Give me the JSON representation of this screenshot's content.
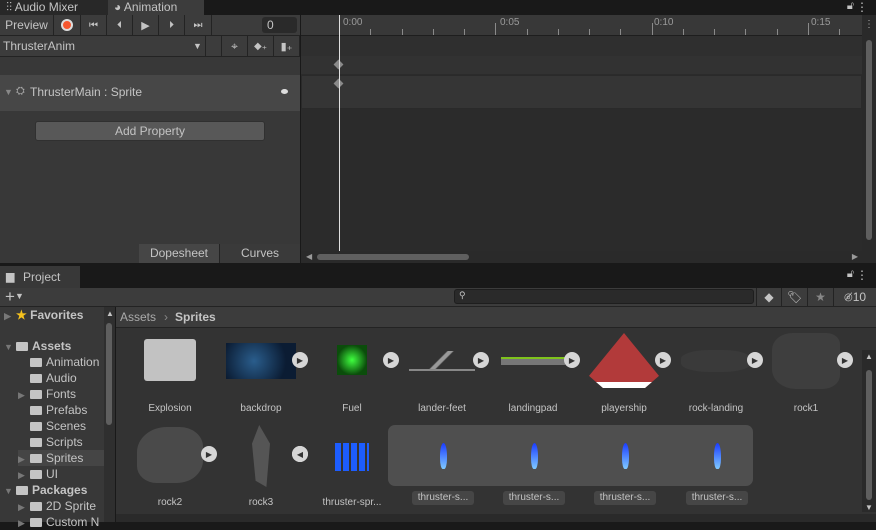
{
  "tabs": {
    "audio_mixer": "Audio Mixer",
    "animation": "Animation"
  },
  "animation": {
    "preview_label": "Preview",
    "frame_value": "0",
    "clip_name": "ThrusterAnim",
    "property_label": "ThrusterMain : Sprite",
    "add_property": "Add Property",
    "mode_tabs": [
      "Dopesheet",
      "Curves"
    ],
    "time_labels": [
      "0:00",
      "0:05",
      "0:10",
      "0:15"
    ]
  },
  "project": {
    "tab_label": "Project",
    "search_placeholder": "",
    "hidden_count": "10",
    "breadcrumb": [
      "Assets",
      "Sprites"
    ],
    "tree": {
      "favorites": "Favorites",
      "assets": "Assets",
      "asset_folders": [
        "Animation",
        "Audio",
        "Fonts",
        "Prefabs",
        "Scenes",
        "Scripts",
        "Sprites",
        "UI"
      ],
      "packages": "Packages",
      "package_folders": [
        "2D Sprite",
        "Custom N"
      ]
    },
    "items_row1": [
      "Explosion",
      "backdrop",
      "Fuel",
      "lander-feet",
      "landingpad",
      "playership",
      "rock-landing",
      "rock1"
    ],
    "items_row2": [
      "rock2",
      "rock3",
      "thruster-spr..."
    ],
    "sub_sprites": [
      "thruster-s...",
      "thruster-s...",
      "thruster-s...",
      "thruster-s..."
    ]
  },
  "colors": {
    "record": "#f5562f",
    "selected": "#454545",
    "panel": "#383838"
  }
}
